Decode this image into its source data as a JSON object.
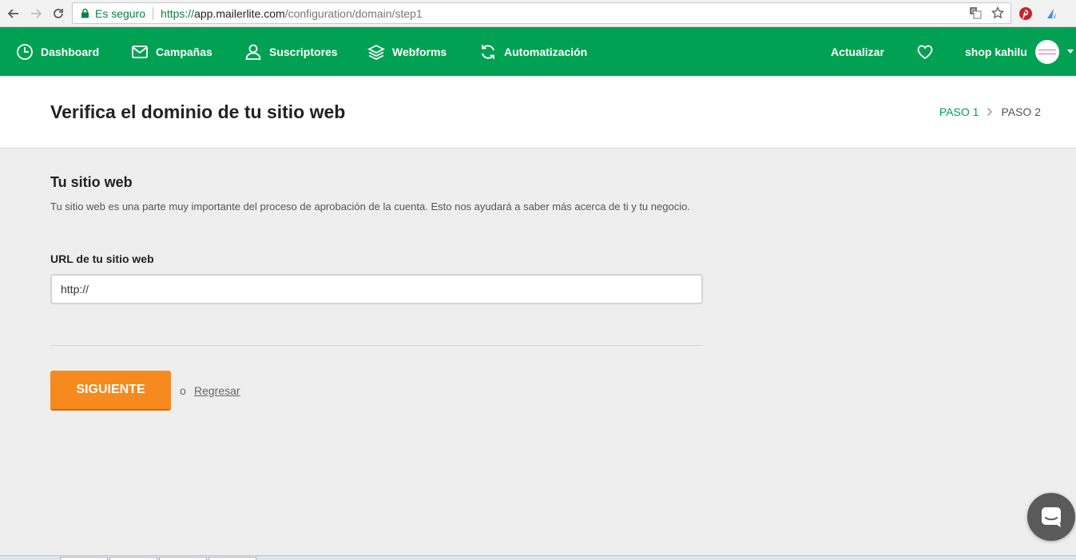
{
  "browser": {
    "secure_label": "Es seguro",
    "url_prefix": "https://",
    "url_host": "app.mailerlite.com",
    "url_path": "/configuration/domain/step1"
  },
  "nav": {
    "items": [
      {
        "label": "Dashboard",
        "icon": "clock-icon"
      },
      {
        "label": "Campañas",
        "icon": "envelope-icon"
      },
      {
        "label": "Suscriptores",
        "icon": "user-icon"
      },
      {
        "label": "Webforms",
        "icon": "layers-icon"
      },
      {
        "label": "Automatización",
        "icon": "refresh-icon"
      }
    ],
    "upgrade_label": "Actualizar",
    "account_name": "shop kahilu",
    "accent_color": "#00a153"
  },
  "header": {
    "title": "Verifica el dominio de tu sitio web",
    "step1": "PASO 1",
    "step2": "PASO 2"
  },
  "form": {
    "section_title": "Tu sitio web",
    "section_desc": "Tu sitio web es una parte muy importante del proceso de aprobación de la cuenta. Esto nos ayudará a saber más acerca de ti y tu negocio.",
    "url_label": "URL de tu sitio web",
    "url_value": "http://",
    "next_label": "SIGUIENTE",
    "or_text": "o",
    "back_label": "Regresar",
    "button_color": "#f68a1f"
  }
}
